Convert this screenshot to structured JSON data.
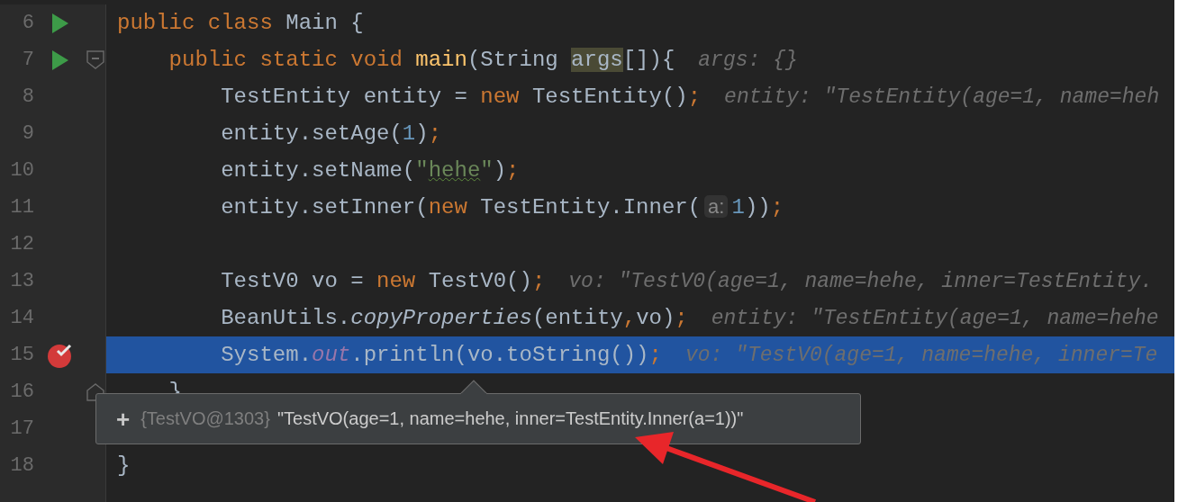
{
  "editor": {
    "lines": [
      {
        "number": "6",
        "run": true,
        "breakpoint": false,
        "fold_start": false,
        "fold_end": false,
        "selected": false,
        "tokens": [
          {
            "text": "public class ",
            "kind": "keyword"
          },
          {
            "text": "Main {",
            "kind": "plain"
          }
        ]
      },
      {
        "number": "7",
        "run": true,
        "breakpoint": false,
        "fold_start": true,
        "fold_end": false,
        "selected": false,
        "tokens": [
          {
            "text": "    public static void ",
            "kind": "keyword"
          },
          {
            "text": "main",
            "kind": "method"
          },
          {
            "text": "(String ",
            "kind": "plain"
          },
          {
            "text": "args",
            "kind": "usage"
          },
          {
            "text": "[]){",
            "kind": "plain"
          }
        ],
        "hint": "args: {}"
      },
      {
        "number": "8",
        "run": false,
        "breakpoint": false,
        "fold_start": false,
        "fold_end": false,
        "selected": false,
        "tokens": [
          {
            "text": "        TestEntity entity = ",
            "kind": "plain"
          },
          {
            "text": "new ",
            "kind": "keyword"
          },
          {
            "text": "TestEntity()",
            "kind": "plain"
          },
          {
            "text": ";",
            "kind": "keyword"
          }
        ],
        "hint": "entity: \"TestEntity(age=1, name=heh"
      },
      {
        "number": "9",
        "run": false,
        "breakpoint": false,
        "fold_start": false,
        "fold_end": false,
        "selected": false,
        "tokens": [
          {
            "text": "        entity.setAge(",
            "kind": "plain"
          },
          {
            "text": "1",
            "kind": "number"
          },
          {
            "text": ")",
            "kind": "plain"
          },
          {
            "text": ";",
            "kind": "keyword"
          }
        ]
      },
      {
        "number": "10",
        "run": false,
        "breakpoint": false,
        "fold_start": false,
        "fold_end": false,
        "selected": false,
        "tokens": [
          {
            "text": "        entity.setName(",
            "kind": "plain"
          },
          {
            "text": "\"",
            "kind": "string"
          },
          {
            "text": "hehe",
            "kind": "typo"
          },
          {
            "text": "\"",
            "kind": "string"
          },
          {
            "text": ")",
            "kind": "plain"
          },
          {
            "text": ";",
            "kind": "keyword"
          }
        ]
      },
      {
        "number": "11",
        "run": false,
        "breakpoint": false,
        "fold_start": false,
        "fold_end": false,
        "selected": false,
        "tokens": [
          {
            "text": "        entity.setInner(",
            "kind": "plain"
          },
          {
            "text": "new ",
            "kind": "keyword"
          },
          {
            "text": "TestEntity.Inner(",
            "kind": "plain"
          },
          {
            "text": "a:",
            "kind": "param"
          },
          {
            "text": "1",
            "kind": "number"
          },
          {
            "text": "))",
            "kind": "plain"
          },
          {
            "text": ";",
            "kind": "keyword"
          }
        ]
      },
      {
        "number": "12",
        "run": false,
        "breakpoint": false,
        "fold_start": false,
        "fold_end": false,
        "selected": false
      },
      {
        "number": "13",
        "run": false,
        "breakpoint": false,
        "fold_start": false,
        "fold_end": false,
        "selected": false,
        "tokens": [
          {
            "text": "        TestV0 vo = ",
            "kind": "plain"
          },
          {
            "text": "new ",
            "kind": "keyword"
          },
          {
            "text": "TestV0()",
            "kind": "plain"
          },
          {
            "text": ";",
            "kind": "keyword"
          }
        ],
        "hint": "vo: \"TestV0(age=1, name=hehe, inner=TestEntity."
      },
      {
        "number": "14",
        "run": false,
        "breakpoint": false,
        "fold_start": false,
        "fold_end": false,
        "selected": false,
        "tokens": [
          {
            "text": "        BeanUtils.",
            "kind": "plain"
          },
          {
            "text": "copyProperties",
            "kind": "static"
          },
          {
            "text": "(entity",
            "kind": "plain"
          },
          {
            "text": ",",
            "kind": "keyword"
          },
          {
            "text": "vo)",
            "kind": "plain"
          },
          {
            "text": ";",
            "kind": "keyword"
          }
        ],
        "hint": "entity: \"TestEntity(age=1, name=hehe"
      },
      {
        "number": "15",
        "run": false,
        "breakpoint": true,
        "fold_start": false,
        "fold_end": false,
        "selected": true,
        "tokens": [
          {
            "text": "        System.",
            "kind": "plain"
          },
          {
            "text": "out",
            "kind": "field"
          },
          {
            "text": ".println(vo.toString())",
            "kind": "plain"
          },
          {
            "text": ";",
            "kind": "keyword"
          }
        ],
        "hint": "vo: \"TestV0(age=1, name=hehe, inner=Te"
      },
      {
        "number": "16",
        "run": false,
        "breakpoint": false,
        "fold_start": false,
        "fold_end": true,
        "selected": false,
        "tokens": [
          {
            "text": "    }",
            "kind": "plain"
          }
        ]
      },
      {
        "number": "17",
        "run": false,
        "breakpoint": false,
        "fold_start": false,
        "fold_end": false,
        "selected": false
      },
      {
        "number": "18",
        "run": false,
        "breakpoint": false,
        "fold_start": false,
        "fold_end": false,
        "selected": false,
        "tokens": [
          {
            "text": "}",
            "kind": "plain"
          }
        ]
      }
    ]
  },
  "popup": {
    "expand": "+",
    "object_id": "{TestVO@1303}",
    "value": "\"TestVO(age=1, name=hehe, inner=TestEntity.Inner(a=1))\""
  },
  "annotation": {
    "kind": "arrow"
  }
}
